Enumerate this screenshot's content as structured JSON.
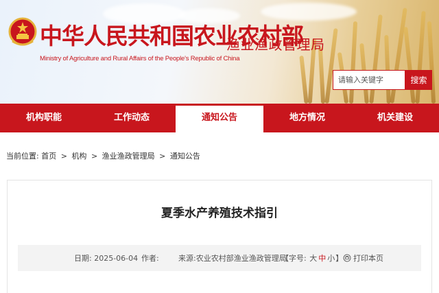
{
  "header": {
    "title_cn": "中华人民共和国农业农村部",
    "title_en": "Ministry of Agriculture and Rural Affairs of the People's Republic of China",
    "department": "渔业渔政管理局",
    "emblem_icon": "national-emblem-icon",
    "brand_color": "#c8161d"
  },
  "search": {
    "placeholder": "请输入关键字",
    "button_label": "搜索"
  },
  "nav": {
    "items": [
      {
        "label": "机构职能"
      },
      {
        "label": "工作动态"
      },
      {
        "label": "通知公告",
        "active": true
      },
      {
        "label": "地方情况"
      },
      {
        "label": "机关建设"
      }
    ]
  },
  "breadcrumb": {
    "prefix": "当前位置:",
    "items": [
      "首页",
      "机构",
      "渔业渔政管理局",
      "通知公告"
    ],
    "separator": ">"
  },
  "article": {
    "title": "夏季水产养殖技术指引",
    "date_label": "日期:",
    "date": "2025-06-04",
    "author_label": "作者:",
    "author": "",
    "source_label": "来源:",
    "source": "农业农村部渔业渔政管理局",
    "font_size_label": "【字号:",
    "font_sizes": [
      "大",
      "中",
      "小"
    ],
    "font_size_close": "】",
    "print_label": "打印本页",
    "print_icon": "print-icon"
  }
}
